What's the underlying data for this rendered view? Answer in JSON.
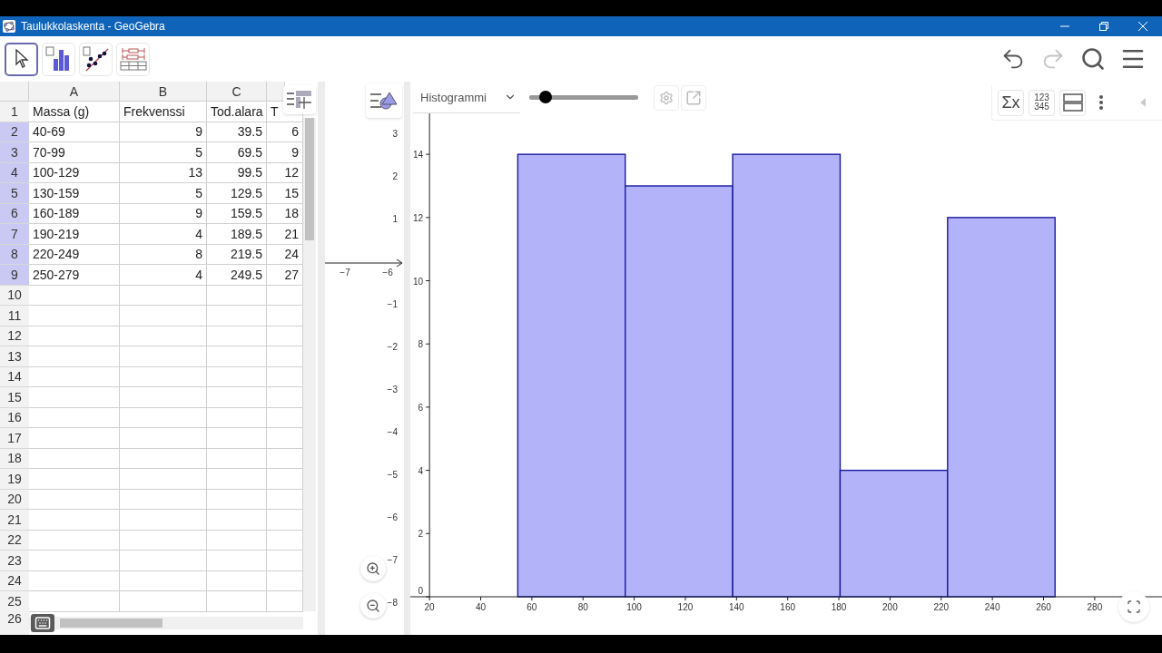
{
  "window": {
    "title": "Taulukkolaskenta - GeoGebra"
  },
  "tools": [
    {
      "kind": "move",
      "selected": true
    },
    {
      "kind": "histogram",
      "selected": false
    },
    {
      "kind": "regression",
      "selected": false
    },
    {
      "kind": "boxplot",
      "selected": false
    }
  ],
  "spreadsheet": {
    "columns": [
      "A",
      "B",
      "C"
    ],
    "rows": [
      {
        "label": "1",
        "selected": false,
        "cells": [
          "Massa (g)",
          "Frekvenssi",
          "Tod.alara",
          "T"
        ]
      },
      {
        "label": "2",
        "selected": true,
        "cells": [
          "40-69",
          "9",
          "39.5",
          "6"
        ]
      },
      {
        "label": "3",
        "selected": true,
        "cells": [
          "70-99",
          "5",
          "69.5",
          "9"
        ]
      },
      {
        "label": "4",
        "selected": true,
        "cells": [
          "100-129",
          "13",
          "99.5",
          "12"
        ]
      },
      {
        "label": "5",
        "selected": true,
        "cells": [
          "130-159",
          "5",
          "129.5",
          "15"
        ]
      },
      {
        "label": "6",
        "selected": true,
        "cells": [
          "160-189",
          "9",
          "159.5",
          "18"
        ]
      },
      {
        "label": "7",
        "selected": true,
        "cells": [
          "190-219",
          "4",
          "189.5",
          "21"
        ]
      },
      {
        "label": "8",
        "selected": true,
        "cells": [
          "220-249",
          "8",
          "219.5",
          "24"
        ]
      },
      {
        "label": "9",
        "selected": true,
        "cells": [
          "250-279",
          "4",
          "249.5",
          "27"
        ]
      },
      {
        "label": "10",
        "selected": false
      },
      {
        "label": "11",
        "selected": false
      },
      {
        "label": "12",
        "selected": false
      },
      {
        "label": "13",
        "selected": false
      },
      {
        "label": "14",
        "selected": false
      },
      {
        "label": "15",
        "selected": false
      },
      {
        "label": "16",
        "selected": false
      },
      {
        "label": "17",
        "selected": false
      },
      {
        "label": "18",
        "selected": false
      },
      {
        "label": "19",
        "selected": false
      },
      {
        "label": "20",
        "selected": false
      },
      {
        "label": "21",
        "selected": false
      },
      {
        "label": "22",
        "selected": false
      },
      {
        "label": "23",
        "selected": false
      },
      {
        "label": "24",
        "selected": false
      },
      {
        "label": "25",
        "selected": false
      },
      {
        "label": "26",
        "selected": false
      }
    ]
  },
  "graphics_view": {
    "x_tick_labels": [
      "−7",
      "−6"
    ],
    "y_tick_labels": [
      "3",
      "2",
      "1",
      "−1",
      "−2",
      "−3",
      "−4",
      "−5",
      "−6",
      "−7",
      "−8"
    ]
  },
  "statistics_view": {
    "view_menu": {
      "value": "Histogrammi"
    },
    "slider": {
      "level": 0.15
    },
    "sum_label": "Σx",
    "data_labels": [
      "123",
      "345"
    ],
    "chart_data": {
      "type": "bar",
      "x": [
        75.5,
        117.5,
        159.5,
        201.5,
        243.5
      ],
      "series": [
        {
          "color": "#b3b3fa",
          "values": [
            14,
            13,
            14,
            4,
            12
          ]
        }
      ],
      "xlim": [
        12.5,
        306.3
      ],
      "ylim": [
        0,
        16.3
      ],
      "xticks": [
        20,
        40,
        60,
        80,
        100,
        120,
        140,
        160,
        180,
        200,
        220,
        240,
        260,
        280
      ],
      "yticks": [
        0,
        2,
        4,
        6,
        8,
        10,
        12,
        14
      ]
    }
  }
}
